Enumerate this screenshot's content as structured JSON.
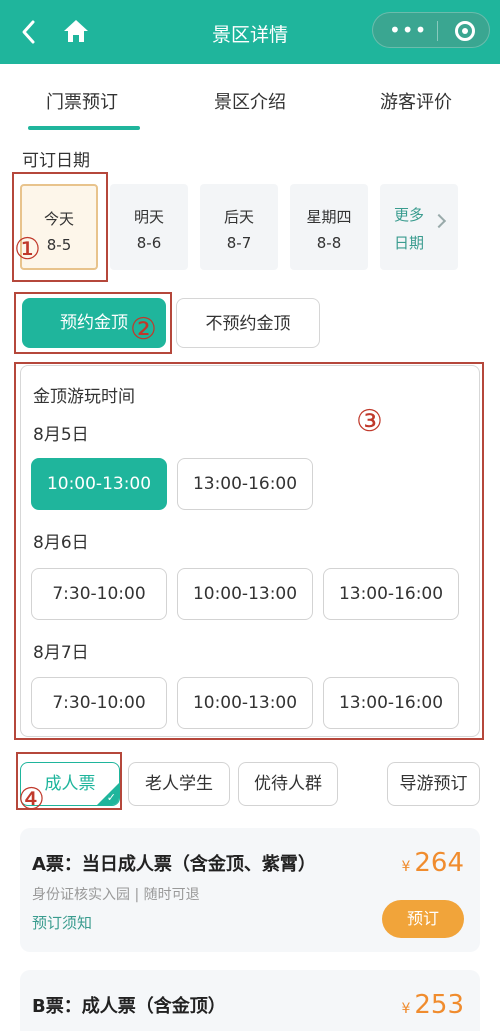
{
  "header": {
    "title": "景区详情",
    "back_icon": "chevron-left-icon",
    "home_icon": "home-icon",
    "more_icon": "more-dots-icon",
    "close_icon": "target-circle-icon",
    "color": "#1fb59c"
  },
  "tabs": [
    {
      "label": "门票预订",
      "active": true
    },
    {
      "label": "景区介绍",
      "active": false
    },
    {
      "label": "游客评价",
      "active": false
    }
  ],
  "dates": {
    "label": "可订日期",
    "items": [
      {
        "day": "今天",
        "date": "8-5",
        "selected": true
      },
      {
        "day": "明天",
        "date": "8-6",
        "selected": false
      },
      {
        "day": "后天",
        "date": "8-7",
        "selected": false
      },
      {
        "day": "星期四",
        "date": "8-8",
        "selected": false
      }
    ],
    "more_line1": "更多",
    "more_line2": "日期"
  },
  "summit_toggle": {
    "on": "预约金顶",
    "off": "不预约金顶"
  },
  "summit_panel": {
    "title": "金顶游玩时间",
    "days": [
      {
        "label": "8月5日",
        "slots": [
          {
            "time": "10:00-13:00",
            "selected": true
          },
          {
            "time": "13:00-16:00",
            "selected": false
          }
        ]
      },
      {
        "label": "8月6日",
        "slots": [
          {
            "time": "7:30-10:00",
            "selected": false
          },
          {
            "time": "10:00-13:00",
            "selected": false
          },
          {
            "time": "13:00-16:00",
            "selected": false
          }
        ]
      },
      {
        "label": "8月7日",
        "slots": [
          {
            "time": "7:30-10:00",
            "selected": false
          },
          {
            "time": "10:00-13:00",
            "selected": false
          },
          {
            "time": "13:00-16:00",
            "selected": false
          }
        ]
      }
    ]
  },
  "ticket_types": [
    {
      "label": "成人票",
      "selected": true
    },
    {
      "label": "老人学生",
      "selected": false
    },
    {
      "label": "优待人群",
      "selected": false
    },
    {
      "label": "导游预订",
      "selected": false
    }
  ],
  "tickets": [
    {
      "name": "A票：当日成人票（含金顶、紫霄）",
      "sub": "身份证核实入园 | 随时可退",
      "notice": "预订须知",
      "currency": "¥",
      "price": "264",
      "button": "预订"
    },
    {
      "name": "B票：成人票（含金顶）",
      "currency": "¥",
      "price": "253"
    }
  ],
  "annotations": [
    "①",
    "②",
    "③",
    "④"
  ],
  "colors": {
    "accent": "#1fb59c",
    "price": "#f08c2e",
    "book": "#f1a43a",
    "annotation": "#c0392b"
  }
}
